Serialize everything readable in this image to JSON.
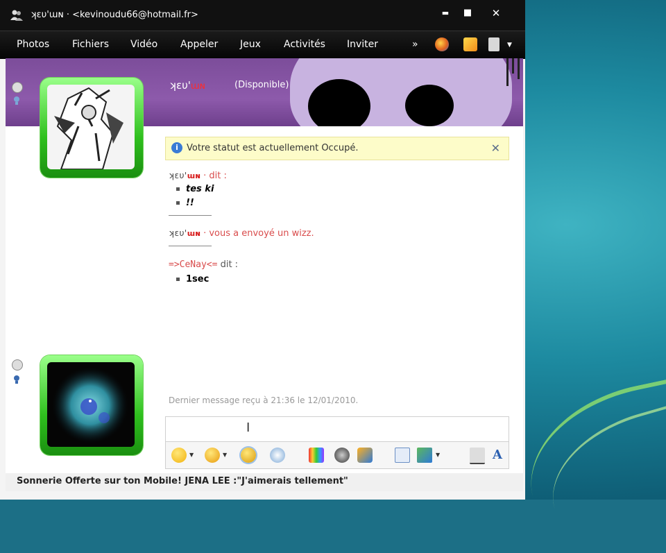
{
  "window": {
    "title_nick": "ʞɛυ'ɯɴ",
    "title_email": " · <kevinoudu66@hotmail.fr>",
    "buttons": {
      "minimize": "▬",
      "maximize": "■",
      "close": "✕"
    }
  },
  "menu": {
    "items": [
      "Photos",
      "Fichiers",
      "Vidéo",
      "Appeler",
      "Jeux",
      "Activités",
      "Inviter"
    ],
    "overflow": "»"
  },
  "header": {
    "contact_name": "ʞɛυ'",
    "contact_name_red": "ɯɴ",
    "contact_status": "(Disponible)"
  },
  "notice": {
    "text": "Votre statut est actuellement Occupé.",
    "close": "✕"
  },
  "conversation": [
    {
      "nick": "ʞɛυ'",
      "nick_red": "ɯɴ",
      "suffix": " · dit :",
      "lines": [
        "tes ki",
        "!!"
      ]
    },
    {
      "nick": "ʞɛυ'",
      "nick_red": "ɯɴ",
      "suffix": " · vous a envoyé un wizz."
    },
    {
      "nick": "=>CeNay<=",
      "suffix": " dit :",
      "lines": [
        "1sec"
      ]
    }
  ],
  "last_message": "Dernier message reçu à 21:36 le 12/01/2010.",
  "status_bar": "Sonnerie Offerte sur ton Mobile! JENA LEE :\"J'aimerais tellement\"",
  "colors": {
    "header_purple": "#8d5aab",
    "avatar_green": "#2fc01e",
    "nick_red": "#d81e1e",
    "notice_yellow": "#fdfcc9"
  },
  "icons": [
    "emoticon-icon",
    "wink-icon",
    "animoticon-icon",
    "nudge-icon",
    "background-icon",
    "sound-icon",
    "game-icon",
    "spellcheck-icon",
    "screenshot-icon",
    "handwriting-icon",
    "font-icon"
  ]
}
